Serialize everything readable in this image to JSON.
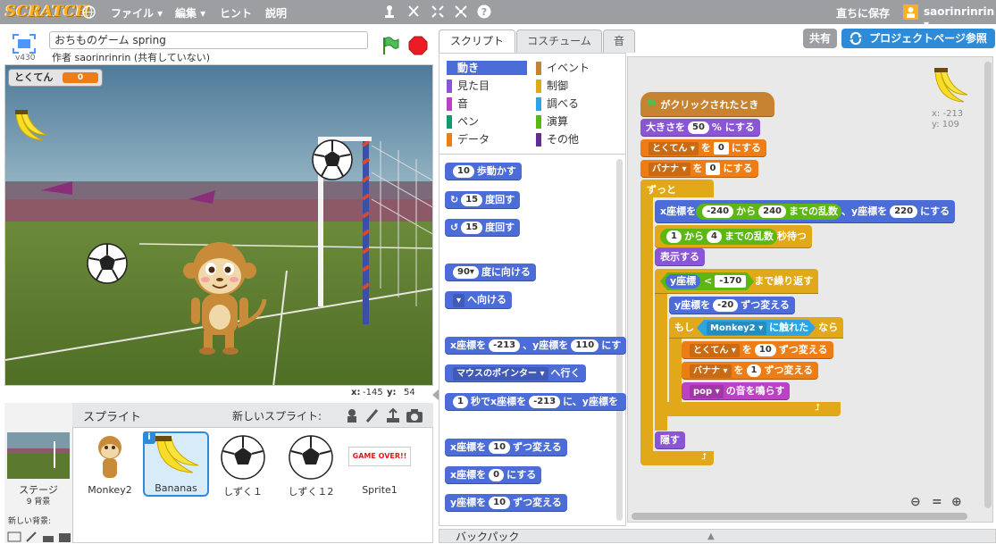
{
  "menu": {
    "logo": "SCRATCH",
    "file": "ファイル ▾",
    "edit": "編集 ▾",
    "tips": "ヒント",
    "about": "説明",
    "save_now": "直ちに保存",
    "user": "saorinrinrin ▾"
  },
  "project": {
    "title": "おちものゲーム spring",
    "author": "作者 saorinrinrin (共有していない)",
    "version": "v430"
  },
  "stage": {
    "variable_label": "とくてん",
    "variable_value": "0",
    "x_label": "x:",
    "x_value": "-145",
    "y_label": "y:",
    "y_value": "54"
  },
  "sprites": {
    "header": "スプライト",
    "new_sprite": "新しいスプライト:",
    "stage_label": "ステージ",
    "stage_bg": "9 背景",
    "new_bg": "新しい背景:",
    "items": [
      "Monkey2",
      "Bananas",
      "しずく１",
      "しずく１2",
      "Sprite1"
    ],
    "gameover_text": "GAME OVER!!"
  },
  "tabs": [
    "スクリプト",
    "コスチューム",
    "音"
  ],
  "buttons": {
    "share": "共有",
    "project_page": "プロジェクトページ参照"
  },
  "categories": [
    "動き",
    "イベント",
    "見た目",
    "制御",
    "音",
    "調べる",
    "ペン",
    "演算",
    "データ",
    "その他"
  ],
  "palette": {
    "move": "歩動かす",
    "move_n": "10",
    "turn_r": "度回す",
    "turn_r_n": "15",
    "turn_l": "度回す",
    "turn_l_n": "15",
    "point_dir": "度に向ける",
    "point_dir_n": "90▾",
    "point_to": "へ向ける",
    "goto_xy_a": "x座標を",
    "goto_xy_x": "-213",
    "goto_xy_b": "、y座標を",
    "goto_xy_y": "110",
    "goto_xy_c": "にす",
    "goto_ptr": "マウスのポインター ▾",
    "goto_ptr_b": "へ行く",
    "glide_n": "1",
    "glide_a": "秒でx座標を",
    "glide_x": "-213",
    "glide_b": "に、y座標を",
    "chg_x_a": "x座標を",
    "chg_x_n": "10",
    "chg_x_b": "ずつ変える",
    "set_x_a": "x座標を",
    "set_x_n": "0",
    "set_x_b": "にする",
    "chg_y_a": "y座標を",
    "chg_y_n": "10",
    "chg_y_b": "ずつ変える"
  },
  "script": {
    "hat": "がクリックされたとき",
    "size_a": "大きさを",
    "size_n": "50",
    "size_b": "% にする",
    "var1": "とくてん ▾",
    "var1_a": "を",
    "var1_n": "0",
    "var1_b": "にする",
    "var2": "バナナ ▾",
    "var2_a": "を",
    "var2_n": "0",
    "var2_b": "にする",
    "forever": "ずっと",
    "goto_a": "x座標を",
    "goto_r1": "-240",
    "goto_b": "から",
    "goto_r2": "240",
    "goto_c": "までの乱数",
    "goto_d": "、y座標を",
    "goto_y": "220",
    "goto_e": "にする",
    "wait_a": "1",
    "wait_b": "から",
    "wait_c": "4",
    "wait_d": "までの乱数",
    "wait_e": "秒待つ",
    "show": "表示する",
    "until_a": "y座標",
    "until_op": "<",
    "until_n": "-170",
    "until_b": "まで繰り返す",
    "chgy_a": "y座標を",
    "chgy_n": "-20",
    "chgy_b": "ずつ変える",
    "if_a": "もし",
    "if_touch": "Monkey2 ▾",
    "if_b": "に触れた",
    "if_c": "なら",
    "inc1": "とくてん ▾",
    "inc1_a": "を",
    "inc1_n": "10",
    "inc1_b": "ずつ変える",
    "inc2": "バナナ ▾",
    "inc2_a": "を",
    "inc2_n": "1",
    "inc2_b": "ずつ変える",
    "snd": "pop ▾",
    "snd_b": "の音を鳴らす",
    "hide": "隠す",
    "sprite_x": "x: -213",
    "sprite_y": "y: 109"
  },
  "backpack": "バックパック"
}
